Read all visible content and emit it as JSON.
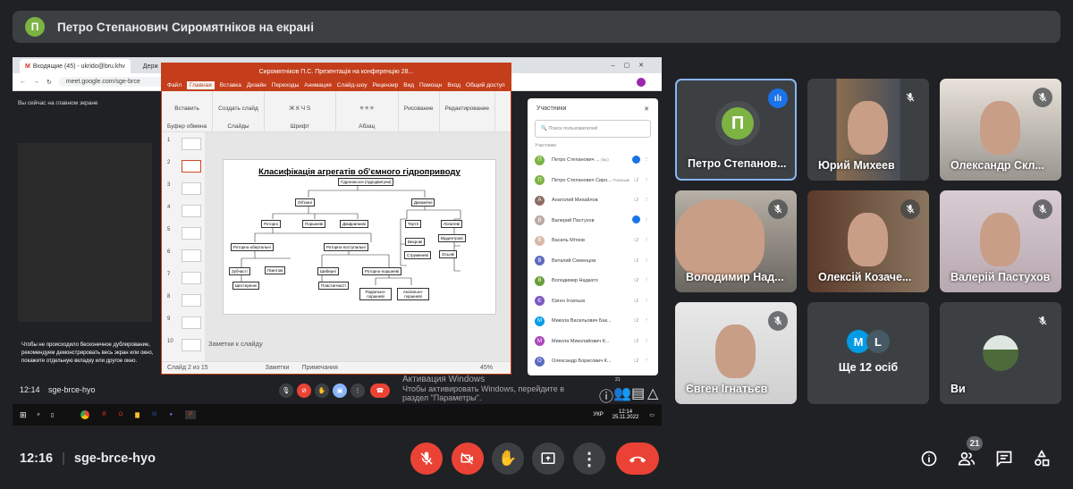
{
  "banner": {
    "avatar_letter": "П",
    "text": "Петро Степанович Сиромятніков на екрані"
  },
  "shared_screen": {
    "browser": {
      "tab1": "Входящие (45) - ukrido@bru.khv",
      "tab2": "Держ",
      "url": "meet.google.com/sge-brce"
    },
    "meet_inner": {
      "presenting_notice": "Вы сейчас на главном экране",
      "warning_text": "Чтобы не происходило бесконечное дублирование, рекомендуем демонстрировать весь экран или окно, покажите отдельную вкладку или другое окно.",
      "time": "12:14",
      "code": "sge-brce-hyo",
      "people_badge": "21"
    },
    "powerpoint": {
      "title": "Сиромятніков П.С. Презентація на конференцію 28...",
      "menu": [
        "Файл",
        "Главная",
        "Вставка",
        "Дизайн",
        "Переходы",
        "Анимация",
        "Слайд-шоу",
        "Рецензир",
        "Вид",
        "Помощн",
        "Вход",
        "Общий доступ"
      ],
      "ribbon": [
        "Вставить",
        "Создать слайд",
        "Рисование",
        "Редактирование"
      ],
      "ribbon_groups": [
        "Буфер обмена",
        "Слайды",
        "Шрифт",
        "Абзац"
      ],
      "thumb_numbers": [
        "1",
        "2",
        "3",
        "4",
        "5",
        "6",
        "7",
        "8",
        "9",
        "10"
      ],
      "slide_title": "Класифікація агрегатів об'ємного гідроприводу",
      "diagram": [
        "Гідронасоси (гідродвигуни)",
        "Об'ємні",
        "Динамічні",
        "Роторні",
        "Поршневі",
        "Діафрагмові",
        "Тертя",
        "Лопатеві",
        "Вихрові",
        "Відцентрові",
        "Струменеві",
        "Осьові",
        "Роторно-обертальні",
        "Роторно-поступальні",
        "Зубчасті",
        "Гвинтові",
        "Шиберні",
        "Роторно-поршневі",
        "Шестеренні",
        "Пластинчасті",
        "Радіально-поршневі",
        "Аксіально-поршневі"
      ],
      "notes": "Заметки к слайду",
      "status": {
        "slide": "Слайд 2 из 15",
        "notes": "Заметки",
        "comments": "Примечания",
        "zoom": "45%"
      }
    },
    "participants_panel": {
      "title": "Участники",
      "search_placeholder": "Поиск пользователей",
      "section": "Участники",
      "items": [
        {
          "letter": "П",
          "name": "Петро Степанович ...",
          "extra": "(вы)",
          "color": "#7cb342"
        },
        {
          "letter": "П",
          "name": "Петро Степанович Сиро...",
          "extra": "Показывает экран",
          "color": "#7cb342"
        },
        {
          "letter": "А",
          "name": "Анатолий Михайлов",
          "extra": "",
          "color": "#8d6e63"
        },
        {
          "letter": "В",
          "name": "Валерий Пастухов",
          "extra": "",
          "color": "#bcaaa4"
        },
        {
          "letter": "В",
          "name": "Василь Мітков",
          "extra": "",
          "color": "#d7b8a8"
        },
        {
          "letter": "В",
          "name": "Виталий Семенцов",
          "extra": "",
          "color": "#5c6bc0"
        },
        {
          "letter": "В",
          "name": "Володимир Надкато",
          "extra": "",
          "color": "#689f38"
        },
        {
          "letter": "Є",
          "name": "Євген Ігнатьєв",
          "extra": "",
          "color": "#7e57c2"
        },
        {
          "letter": "М",
          "name": "Микола Васильович Бак...",
          "extra": "",
          "color": "#039be5"
        },
        {
          "letter": "М",
          "name": "Микола Миколайович К...",
          "extra": "",
          "color": "#ab47bc"
        },
        {
          "letter": "О",
          "name": "Олександр Борисович К...",
          "extra": "",
          "color": "#5c6bc0"
        }
      ]
    },
    "activation": {
      "line1": "Активация Windows",
      "line2": "Чтобы активировать Windows, перейдите в",
      "line3": "раздел \"Параметры\"."
    },
    "taskbar": {
      "lang": "УКР",
      "time": "12:14",
      "date": "25.11.2022"
    }
  },
  "tiles": [
    {
      "name": "Петро Степанов...",
      "avatar": "П",
      "speaking": true
    },
    {
      "name": "Юрий Михеев"
    },
    {
      "name": "Олександр Скл..."
    },
    {
      "name": "Володимир Над..."
    },
    {
      "name": "Олексій Козаче..."
    },
    {
      "name": "Валерій Пастухов"
    },
    {
      "name": "Євген Ігнатьєв"
    },
    {
      "name": "Ще 12 осіб",
      "avatars": [
        "M",
        "L"
      ]
    },
    {
      "name": "Ви"
    }
  ],
  "bottom": {
    "time": "12:16",
    "code": "sge-brce-hyo",
    "people_count": "21"
  },
  "colors": {
    "bg": "#202124",
    "red": "#ea4335",
    "blue": "#1a73e8",
    "accent_border": "#8ab4f8"
  }
}
